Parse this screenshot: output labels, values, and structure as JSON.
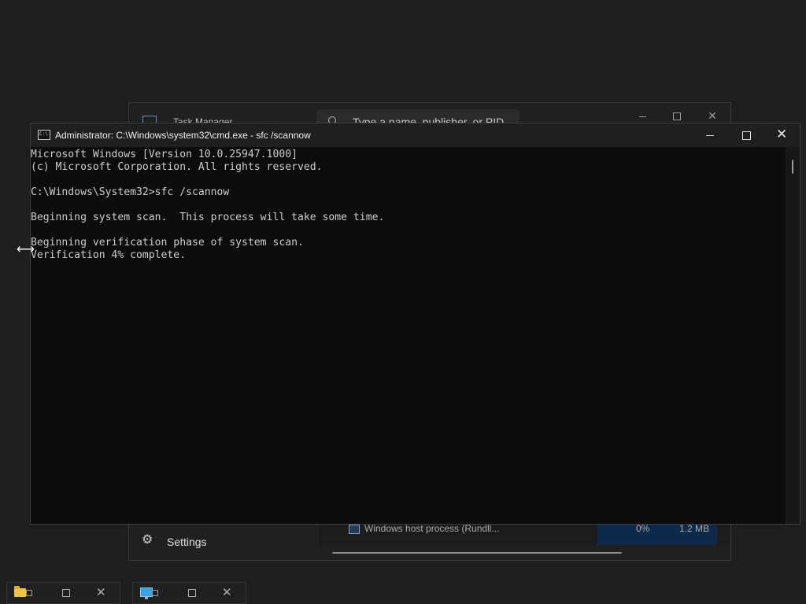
{
  "task_manager": {
    "title": "Task Manager",
    "search_placeholder": "Type a name, publisher, or PID",
    "settings_label": "Settings",
    "process_row": {
      "name": "Windows host process (Rundll...",
      "cpu": "0%",
      "memory": "1.2 MB"
    }
  },
  "cmd": {
    "title": "Administrator: C:\\Windows\\system32\\cmd.exe - sfc  /scannow",
    "icon_text": "C:\\",
    "lines": [
      "Microsoft Windows [Version 10.0.25947.1000]",
      "(c) Microsoft Corporation. All rights reserved.",
      "",
      "C:\\Windows\\System32>sfc /scannow",
      "",
      "Beginning system scan.  This process will take some time.",
      "",
      "Beginning verification phase of system scan.",
      "Verification 4% complete."
    ]
  },
  "icons": {
    "cursor": "resize-horizontal-cursor-icon",
    "taskmanager": "task-manager-icon",
    "search": "search-icon",
    "gear": "gear-icon",
    "folder": "folder-icon",
    "monitor": "monitor-icon"
  }
}
